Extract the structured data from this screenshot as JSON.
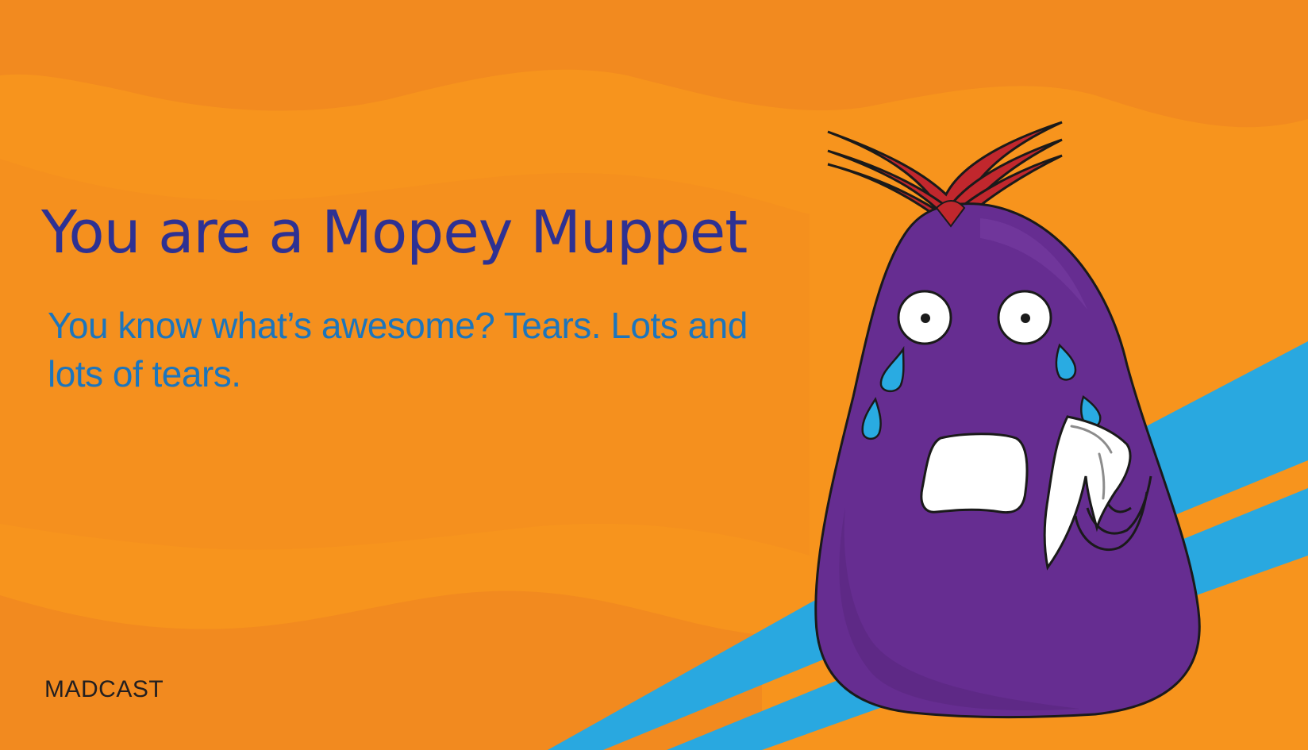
{
  "card": {
    "headline": "You are a Mopey Muppet",
    "description": "You know what’s awesome? Tears. Lots and lots of tears.",
    "brand": "MADCAST"
  },
  "colors": {
    "background": "#f7941d",
    "background_dark": "#f28a1f",
    "stripe": "#29a8e0",
    "headline": "#2e3192",
    "description": "#1c75bc",
    "brand": "#231f20",
    "muppet_body": "#662d91",
    "hair": "#c1272d",
    "tears": "#29abe2",
    "tissue": "#ffffff"
  },
  "illustration": {
    "character": "purple-muppet-crying-icon"
  }
}
